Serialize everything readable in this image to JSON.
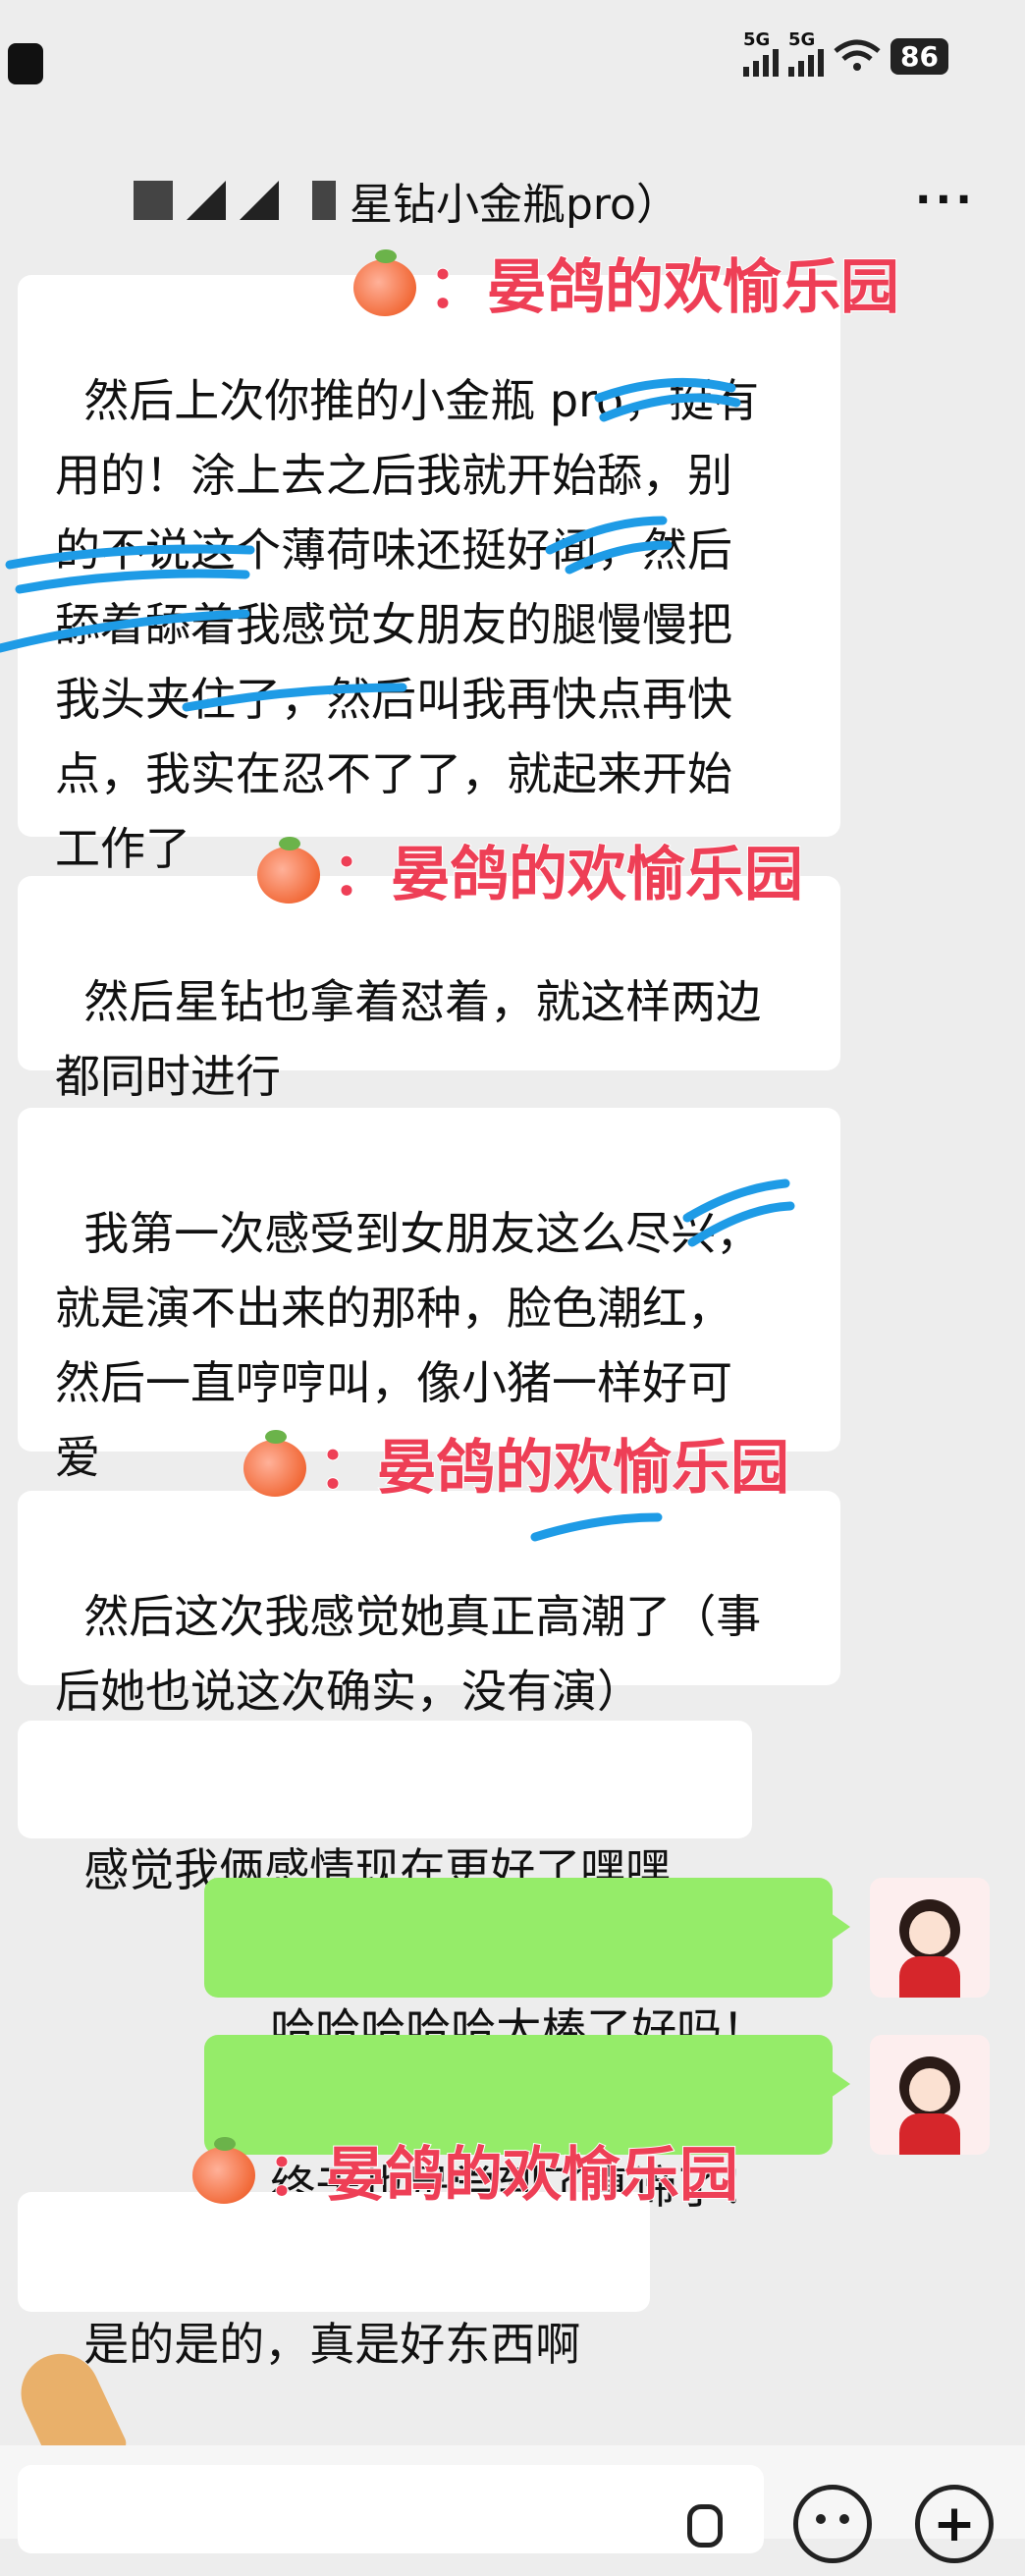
{
  "status": {
    "net1": "5G",
    "net2": "5G",
    "battery": "86"
  },
  "header": {
    "title": "星钻小金瓶pro）",
    "more": "···"
  },
  "messages": [
    {
      "text": "然后上次你推的小金瓶 pro，挺有\n用的！涂上去之后我就开始舔，别\n的不说这个薄荷味还挺好闻，然后\n舔着舔着我感觉女朋友的腿慢慢把\n我头夹住了，然后叫我再快点再快\n点，我实在忍不了了，就起来开始\n工作了"
    },
    {
      "text": "然后星钻也拿着怼着，就这样两边\n都同时进行"
    },
    {
      "text": "我第一次感受到女朋友这么尽兴，\n就是演不出来的那种，脸色潮红，\n然后一直哼哼叫，像小猪一样好可\n爱"
    },
    {
      "text": "然后这次我感觉她真正高潮了（事\n后她也说这次确实，没有演）"
    },
    {
      "text": "感觉我俩感情现在更好了嘿嘿"
    },
    {
      "text": "哈哈哈哈哈太棒了好吗！"
    },
    {
      "text": "终于也是尝到了真谛了！"
    },
    {
      "text": "是的是的，真是好东西啊"
    }
  ],
  "watermark": {
    "text": "：晏鸽的欢愉乐园"
  },
  "bottom": {
    "add": "+"
  }
}
